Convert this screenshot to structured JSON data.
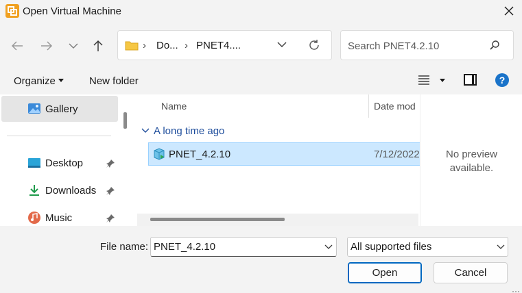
{
  "window": {
    "title": "Open Virtual Machine"
  },
  "nav": {
    "address_segments": [
      "Do...",
      "PNET4...."
    ],
    "search_placeholder": "Search PNET4.2.10"
  },
  "toolbar": {
    "organize": "Organize",
    "new_folder": "New folder",
    "help": "?"
  },
  "sidebar": {
    "items": [
      {
        "label": "Gallery",
        "icon": "gallery-icon",
        "selected": true
      },
      {
        "label": "Desktop",
        "icon": "desktop-icon",
        "pinned": true
      },
      {
        "label": "Downloads",
        "icon": "downloads-icon",
        "pinned": true
      },
      {
        "label": "Music",
        "icon": "music-icon",
        "pinned": true
      }
    ]
  },
  "files": {
    "columns": {
      "name": "Name",
      "date": "Date mod"
    },
    "group_label": "A long time ago",
    "rows": [
      {
        "name": "PNET_4.2.10",
        "date": "7/12/2022",
        "selected": true
      }
    ]
  },
  "preview": {
    "line1": "No preview",
    "line2": "available."
  },
  "bottom": {
    "file_name_label": "File name:",
    "file_name_value": "PNET_4.2.10",
    "filter_value": "All supported files",
    "open_label": "Open",
    "cancel_label": "Cancel"
  },
  "colors": {
    "accent": "#0067c0",
    "selection": "#cce8ff",
    "group": "#1f4e9c"
  }
}
